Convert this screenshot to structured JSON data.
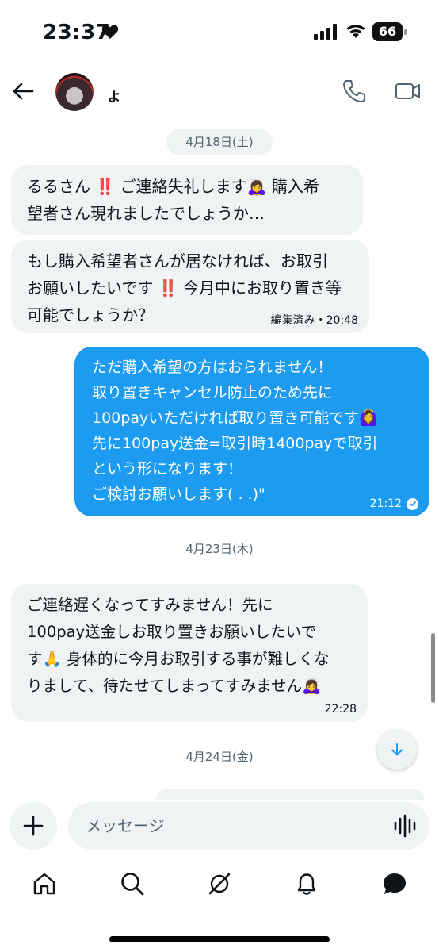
{
  "status_bar": {
    "time": "23:37",
    "battery": "66"
  },
  "header": {
    "contact_name": "ょ"
  },
  "dates": [
    "4月18日(土)",
    "4月23日(木)",
    "4月24日(金)"
  ],
  "messages": [
    {
      "side": "in",
      "lines": [
        "るるさん ‼️ ご連絡失礼します🙇‍♀️ 購入希",
        "望者さん現れましたでしょうか…"
      ],
      "meta": ""
    },
    {
      "side": "in",
      "lines": [
        "もし購入希望者さんが居なければ、お取引",
        "お願いしたいです ‼️ 今月中にお取り置き等",
        "可能でしょうか？"
      ],
      "meta": "編集済み・20:48"
    },
    {
      "side": "out",
      "lines": [
        "ただ購入希望の方はおられません！",
        "取り置きキャンセル防止のため先に",
        "100payいただければ取り置き可能です🙆‍♀️",
        "先に100pay送金=取引時1400payで取引",
        "という形になります！",
        "ご検討お願いします(  . .)\""
      ],
      "meta": "21:12"
    },
    {
      "side": "in",
      "lines": [
        "ご連絡遅くなってすみません！先に",
        "100pay送金しお取り置きお願いしたいで",
        "す🙏 身体的に今月お取引する事が難しくな",
        "りまして、待たせてしまってすみません🙇‍♀️"
      ],
      "meta": "22:28"
    }
  ],
  "composer": {
    "placeholder": "メッセージ"
  },
  "nav": [
    "home-icon",
    "search-icon",
    "grok-icon",
    "bell-icon",
    "messages-icon"
  ],
  "colors": {
    "accent": "#1d9bf0",
    "bubble_in": "#eff3f4"
  }
}
